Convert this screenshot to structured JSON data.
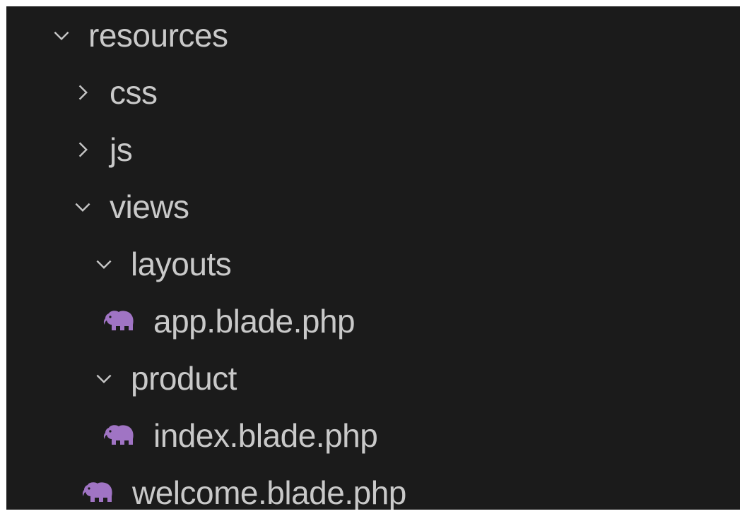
{
  "explorer": {
    "items": [
      {
        "label": "resources",
        "type": "folder",
        "expanded": true,
        "depth": 0,
        "icon": "chevron-down-icon"
      },
      {
        "label": "css",
        "type": "folder",
        "expanded": false,
        "depth": 1,
        "icon": "chevron-right-icon"
      },
      {
        "label": "js",
        "type": "folder",
        "expanded": false,
        "depth": 1,
        "icon": "chevron-right-icon"
      },
      {
        "label": "views",
        "type": "folder",
        "expanded": true,
        "depth": 1,
        "icon": "chevron-down-icon"
      },
      {
        "label": "layouts",
        "type": "folder",
        "expanded": true,
        "depth": 2,
        "icon": "chevron-down-icon"
      },
      {
        "label": "app.blade.php",
        "type": "file",
        "depth": 3,
        "icon": "php-elephant-icon"
      },
      {
        "label": "product",
        "type": "folder",
        "expanded": true,
        "depth": 2,
        "icon": "chevron-down-icon"
      },
      {
        "label": "index.blade.php",
        "type": "file",
        "depth": 3,
        "icon": "php-elephant-icon"
      },
      {
        "label": "welcome.blade.php",
        "type": "file",
        "depth": 2,
        "icon": "php-elephant-icon"
      }
    ]
  },
  "colors": {
    "background": "#1b1b1b",
    "text": "#c9c9c9",
    "chevron": "#c5c5c5",
    "php_icon": "#a074c4"
  }
}
